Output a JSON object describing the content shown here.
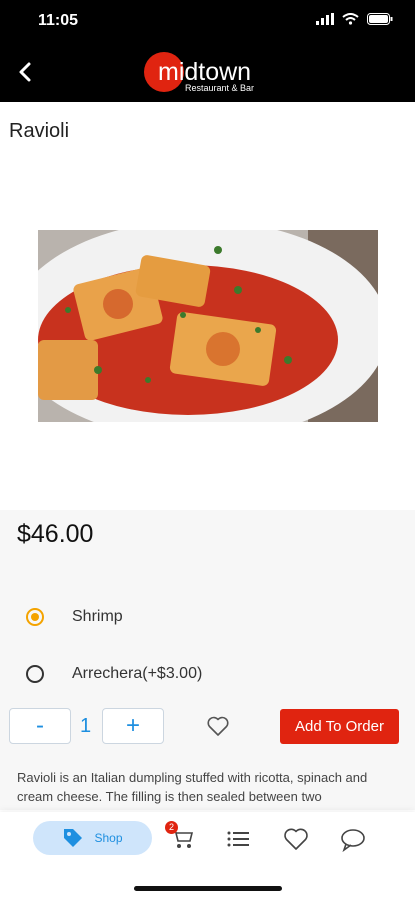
{
  "status": {
    "time": "11:05"
  },
  "header": {
    "logo_text": "midtown",
    "logo_subtext": "Restaurant & Bar"
  },
  "product": {
    "title": "Ravioli",
    "price": "$46.00",
    "options": [
      {
        "label": "Shrimp",
        "selected": true
      },
      {
        "label": "Arrechera(+$3.00)",
        "selected": false
      }
    ],
    "quantity": "1",
    "minus_label": "-",
    "plus_label": "+",
    "add_label": "Add To Order",
    "description": "Ravioli is an Italian dumpling stuffed with ricotta, spinach and cream cheese. The filling is then sealed between two"
  },
  "tabs": {
    "shop_label": "Shop",
    "cart_count": "2"
  },
  "colors": {
    "accent": "#e02410",
    "blue": "#1e8fe0",
    "radio": "#f4a300"
  }
}
